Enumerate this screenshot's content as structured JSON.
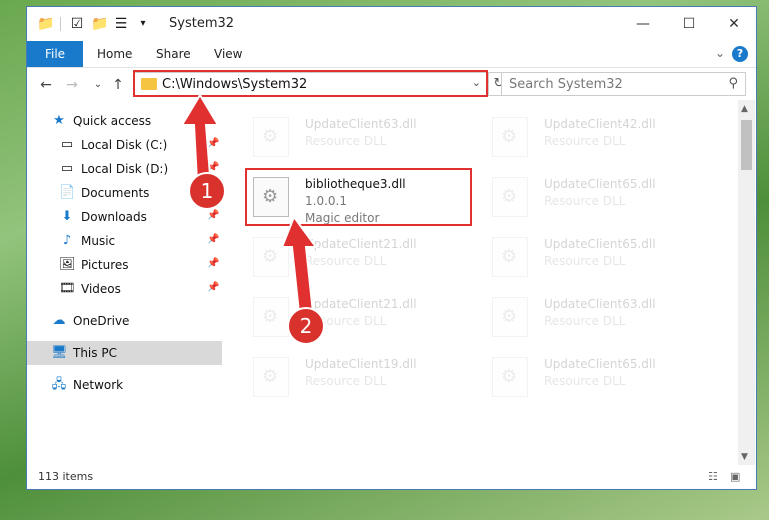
{
  "window": {
    "title": "System32"
  },
  "ribbon": {
    "file": "File",
    "home": "Home",
    "share": "Share",
    "view": "View"
  },
  "address": {
    "path": "C:\\Windows\\System32"
  },
  "search": {
    "placeholder": "Search System32"
  },
  "nav": {
    "quick_access": "Quick access",
    "local_c": "Local Disk (C:)",
    "local_d": "Local Disk (D:)",
    "documents": "Documents",
    "downloads": "Downloads",
    "music": "Music",
    "pictures": "Pictures",
    "videos": "Videos",
    "onedrive": "OneDrive",
    "this_pc": "This PC",
    "network": "Network"
  },
  "files": {
    "f1": {
      "name": "UpdateClient63.dll",
      "type": "Resource DLL"
    },
    "f2": {
      "name": "UpdateClient42.dll",
      "type": "Resource DLL"
    },
    "main": {
      "name": "bibliotheque3.dll",
      "version": "1.0.0.1",
      "desc": "Magic editor"
    },
    "f3": {
      "name": "UpdateClient65.dll",
      "type": "Resource DLL"
    },
    "f4": {
      "name": "UpdateClient21.dll",
      "type": "Resource DLL"
    },
    "f5": {
      "name": "UpdateClient65.dll",
      "type": "Resource DLL"
    },
    "f6": {
      "name": "UpdateClient21.dll",
      "type": "Resource DLL"
    },
    "f7": {
      "name": "UpdateClient63.dll",
      "type": "Resource DLL"
    },
    "f8": {
      "name": "UpdateClient19.dll",
      "type": "Resource DLL"
    },
    "f9": {
      "name": "UpdateClient65.dll",
      "type": "Resource DLL"
    }
  },
  "status": {
    "count": "113 items"
  },
  "annotations": {
    "step1": "1",
    "step2": "2"
  },
  "colors": {
    "accent": "#1979ca",
    "annotation": "#e0302f"
  }
}
